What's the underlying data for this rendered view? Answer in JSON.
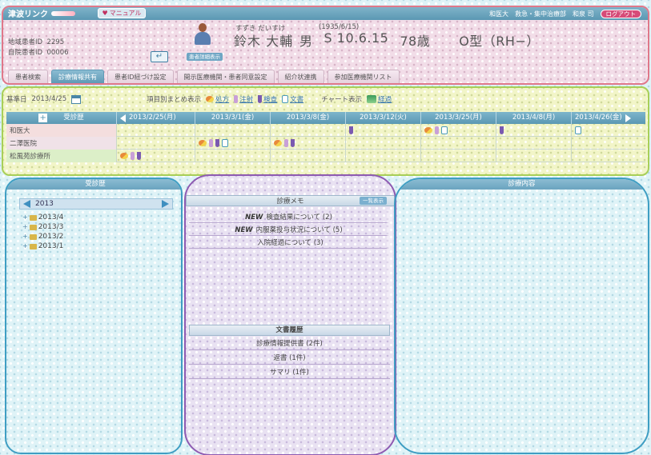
{
  "header": {
    "logo": "津波リンク",
    "manual_label": "マニュアル",
    "user": {
      "facility": "和医大",
      "department": "救急・集中治療部",
      "name": "和泉 司"
    },
    "logout_label": "ログアウト",
    "ids": {
      "regional_label": "地域患者ID",
      "regional_value": "2295",
      "hospital_label": "自院患者ID",
      "hospital_value": "00006"
    },
    "detail_label": "患者詳細表示",
    "patient": {
      "kana": "すずき だいすけ",
      "birth": "(1935/6/15)",
      "name": "鈴木 大輔",
      "sex": "男",
      "dob": "S 10.6.15",
      "age": "78歳",
      "blood": "O型（RH−）"
    },
    "tabs": [
      {
        "label": "患者検索",
        "active": false
      },
      {
        "label": "診療情報共有",
        "active": true
      },
      {
        "label": "患者ID紐づけ設定",
        "active": false
      },
      {
        "label": "開示医療機関・患者同意設定",
        "active": false
      },
      {
        "label": "紹介状連携",
        "active": false
      },
      {
        "label": "参加医療機関リスト",
        "active": false
      }
    ]
  },
  "date_bar": {
    "base_label": "基準日",
    "base_date": "2013/4/25",
    "summary_label": "項目別まとめ表示",
    "legend": {
      "medicine": "処方",
      "injection": "注射",
      "test": "検査",
      "document": "文書"
    },
    "chart_label": "チャート表示",
    "chart_link": "経過"
  },
  "grid": {
    "header_label": "受診歴",
    "dates": [
      "2013/2/25(月)",
      "2013/3/1(金)",
      "2013/3/8(金)",
      "2013/3/12(火)",
      "2013/3/25(月)",
      "2013/4/8(月)",
      "2013/4/26(金)"
    ],
    "hospitals": [
      "和医大",
      "二澤医院",
      "松風苑診療所"
    ]
  },
  "left_panel": {
    "title": "受診歴",
    "year": "2013",
    "months": [
      "2013/4",
      "2013/3",
      "2013/2",
      "2013/1"
    ]
  },
  "middle_panel": {
    "title": "診療メモ",
    "title_btn": "一覧表示",
    "memo_items": [
      {
        "new": "NEW",
        "text": "検査結果について (2)"
      },
      {
        "new": "NEW",
        "text": "内服薬投与状況について (5)"
      },
      {
        "new": "",
        "text": "入院経過について (3)"
      }
    ],
    "doc_title": "文書履歴",
    "docs": [
      "診療情報提供書 (2件)",
      "返書 (1件)",
      "サマリ (1件)"
    ]
  },
  "right_panel": {
    "title": "診療内容"
  }
}
